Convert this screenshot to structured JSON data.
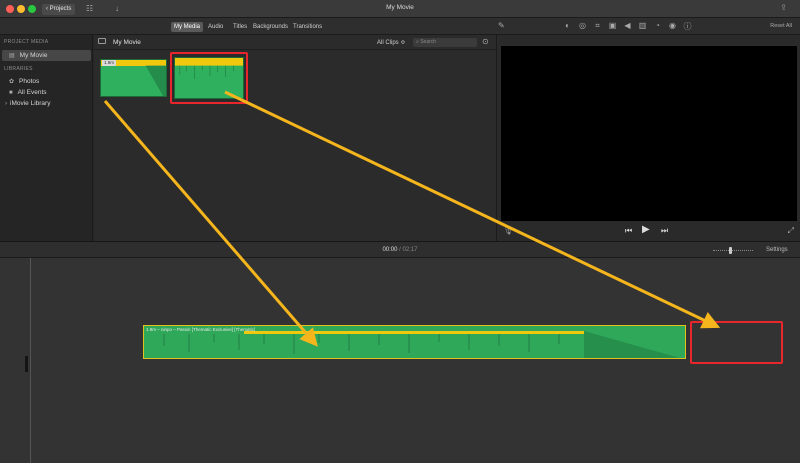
{
  "window": {
    "title": "My Movie",
    "projects_label": "Projects"
  },
  "media_tabs": [
    "My Media",
    "Audio",
    "Titles",
    "Backgrounds",
    "Transitions"
  ],
  "viewer_toolbar": {
    "reset_all": "Reset All"
  },
  "sidebar": {
    "project_media_heading": "PROJECT MEDIA",
    "project_item": "My Movie",
    "libraries_heading": "LIBRARIES",
    "library_items": [
      "Photos",
      "All Events",
      "iMovie Library"
    ]
  },
  "browser": {
    "title": "My Movie",
    "filter": "All Clips ≎",
    "search_placeholder": "Search",
    "clips": [
      {
        "duration": "1.9m"
      }
    ]
  },
  "timeline": {
    "current_time": "00:00",
    "separator": "/",
    "total_time": "02:17",
    "settings_label": "Settings",
    "clip_name": "1.9m – ninpo – Passin [Thematic Exclusive] [Thematic]"
  },
  "colors": {
    "clip_green": "#2fb05e",
    "audio_yellow": "#f0c80e",
    "highlight_red": "#e8262b",
    "arrow_yellow": "#f5b51c"
  }
}
